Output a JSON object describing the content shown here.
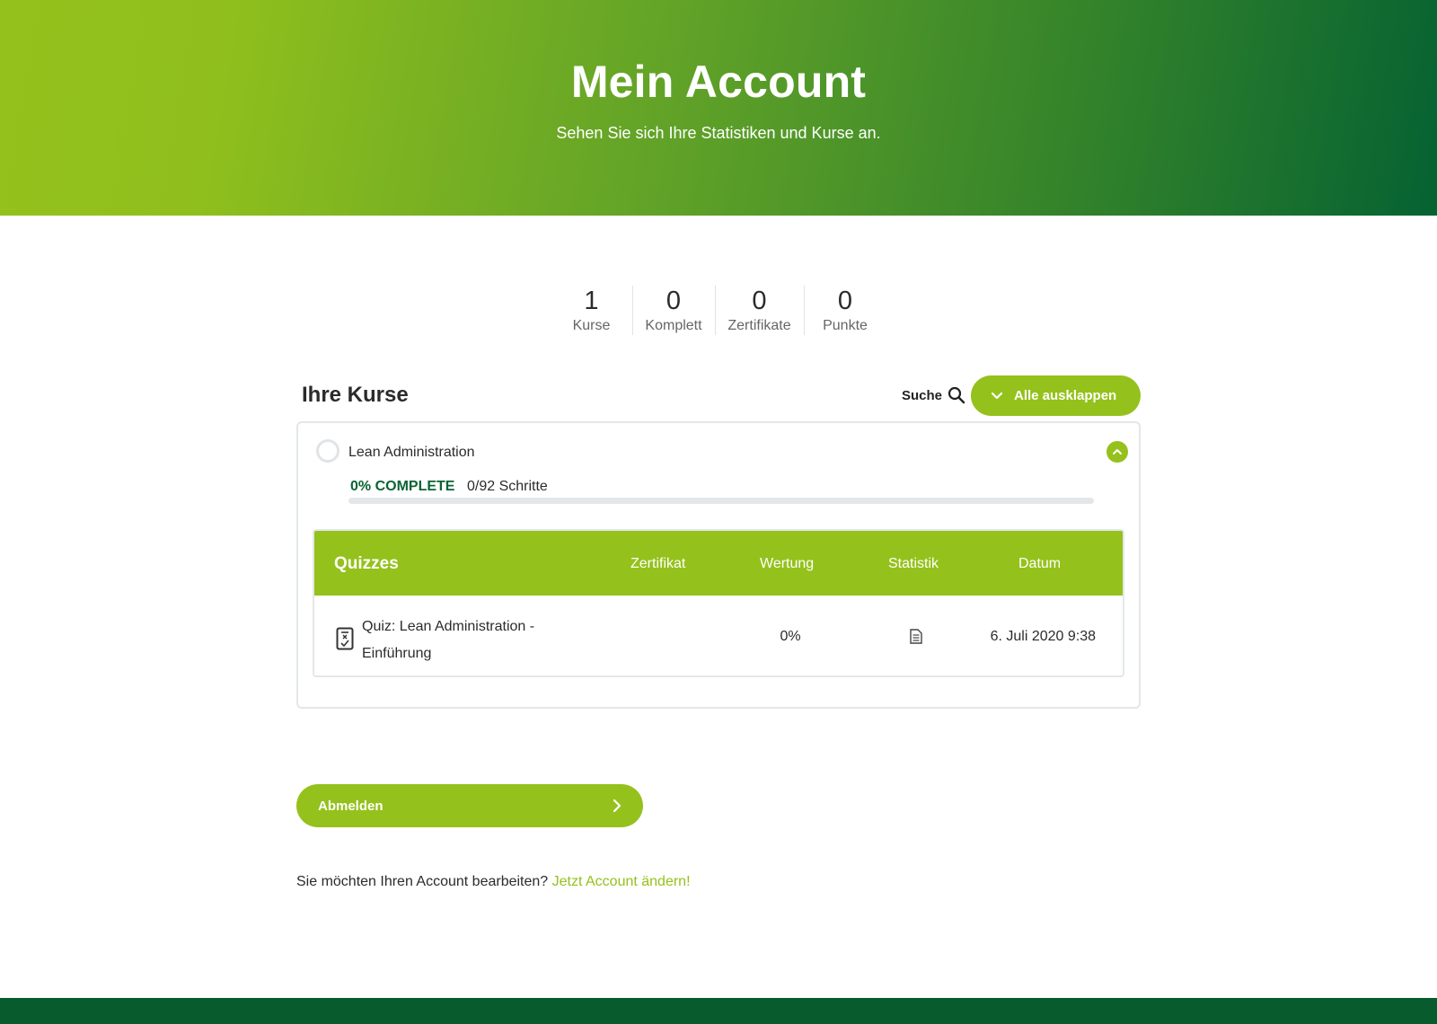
{
  "header": {
    "title": "Mein Account",
    "subtitle": "Sehen Sie sich Ihre Statistiken und Kurse an."
  },
  "stats": [
    {
      "value": "1",
      "label": "Kurse"
    },
    {
      "value": "0",
      "label": "Komplett"
    },
    {
      "value": "0",
      "label": "Zertifikate"
    },
    {
      "value": "0",
      "label": "Punkte"
    }
  ],
  "courses_section": {
    "title": "Ihre Kurse",
    "search_label": "Suche",
    "expand_all_label": "Alle ausklappen"
  },
  "course": {
    "name": "Lean Administration",
    "progress_label": "0% COMPLETE",
    "progress_fraction": 0,
    "steps": "0/92 Schritte"
  },
  "quiz_table": {
    "headers": {
      "quizzes": "Quizzes",
      "certificate": "Zertifikat",
      "score": "Wertung",
      "statistics": "Statistik",
      "date": "Datum"
    },
    "rows": [
      {
        "name": "Quiz: Lean Administration - Einführung",
        "certificate": "",
        "score": "0%",
        "date": "6. Juli 2020 9:38"
      }
    ]
  },
  "logout_label": "Abmelden",
  "edit_account": {
    "prompt": "Sie möchten Ihren Account bearbeiten?",
    "link": "Jetzt Account ändern!"
  },
  "colors": {
    "accent": "#95c11c",
    "dark_green": "#0a6434",
    "footer": "#075b2d"
  },
  "icons": [
    "search-icon",
    "chevron-down-icon",
    "chevron-up-icon",
    "quiz-icon",
    "statistics-document-icon",
    "chevron-right-icon"
  ]
}
